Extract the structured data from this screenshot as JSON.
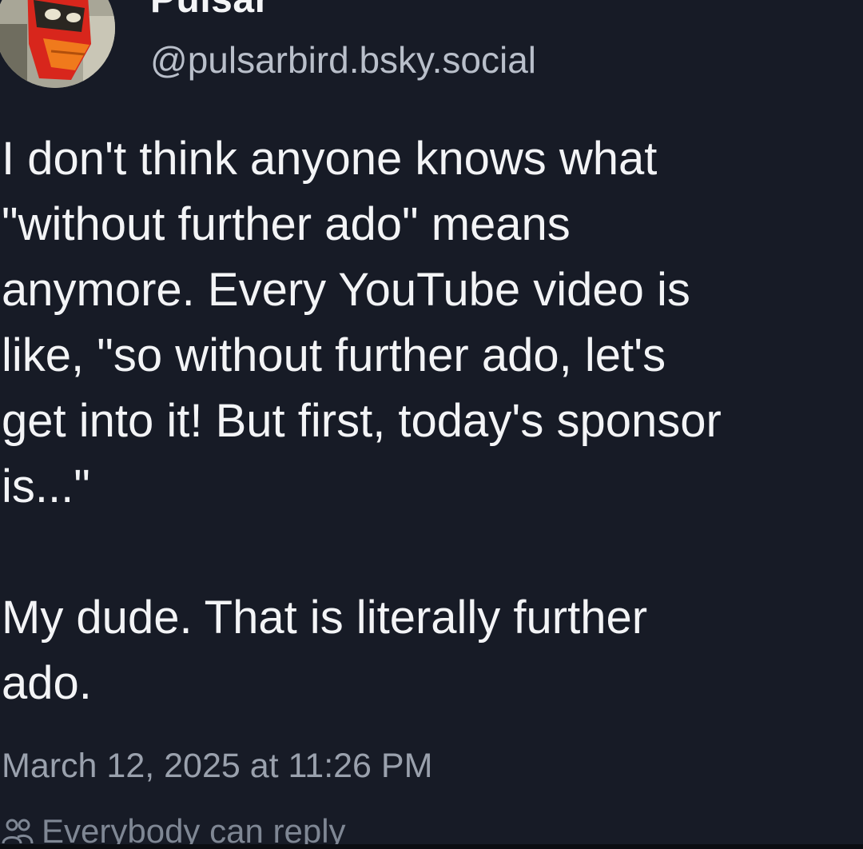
{
  "author": {
    "display_name": "Pulsar",
    "handle": "@pulsarbird.bsky.social",
    "avatar_icon": "red-bird-avatar"
  },
  "post": {
    "text_lines": [
      "I don't think anyone knows what",
      "\"without further ado\" means",
      "anymore. Every YouTube video is",
      "like, \"so without further ado, let's",
      "get into it! But first, today's sponsor",
      "is...\"",
      "",
      "My dude. That is literally further",
      "ado."
    ],
    "timestamp": "March 12, 2025 at 11:26 PM",
    "reply_setting": "Everybody can reply",
    "reply_icon": "people-icon"
  },
  "colors": {
    "background": "#171b26",
    "text": "#f3f4f6",
    "muted": "#9aa1ad",
    "avatar_red": "#d8261c"
  }
}
